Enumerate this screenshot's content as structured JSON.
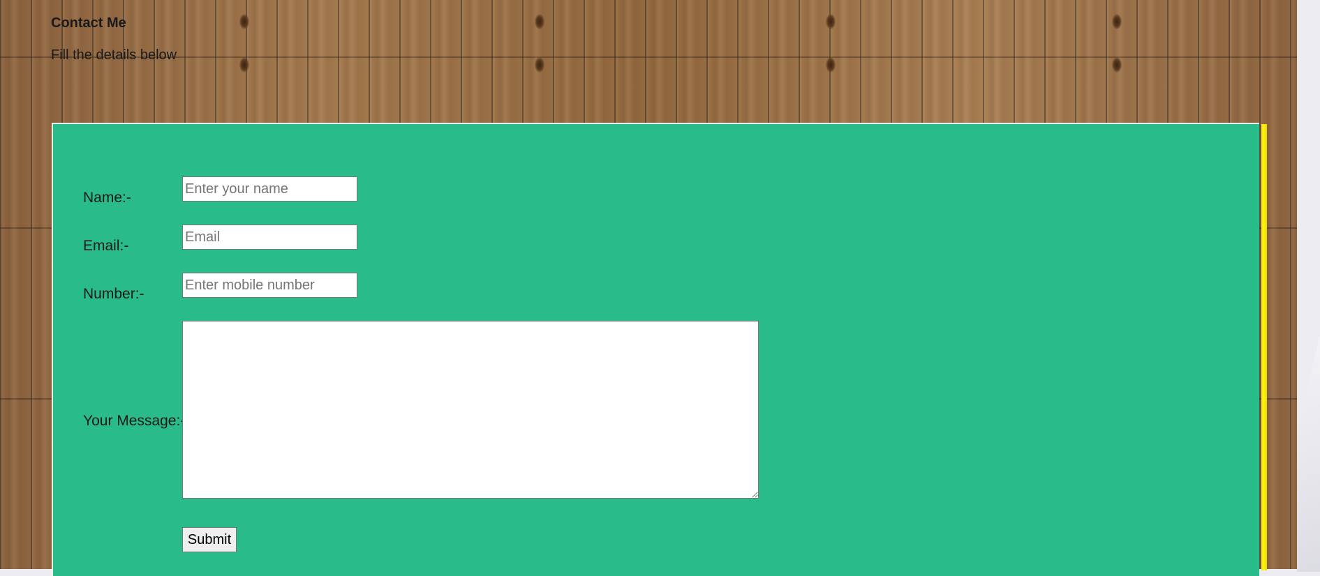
{
  "header": {
    "title": "Contact Me",
    "subtitle": "Fill the details below"
  },
  "form": {
    "name_label": "Name:-",
    "name_placeholder": "Enter your name",
    "email_label": "Email:-",
    "email_placeholder": "Email",
    "number_label": "Number:-",
    "number_placeholder": "Enter mobile number",
    "message_label": "Your Message:-",
    "message_value": "",
    "submit_label": "Submit"
  },
  "colors": {
    "panel_background": "#29bb89",
    "panel_accent_edge": "#fff600"
  }
}
